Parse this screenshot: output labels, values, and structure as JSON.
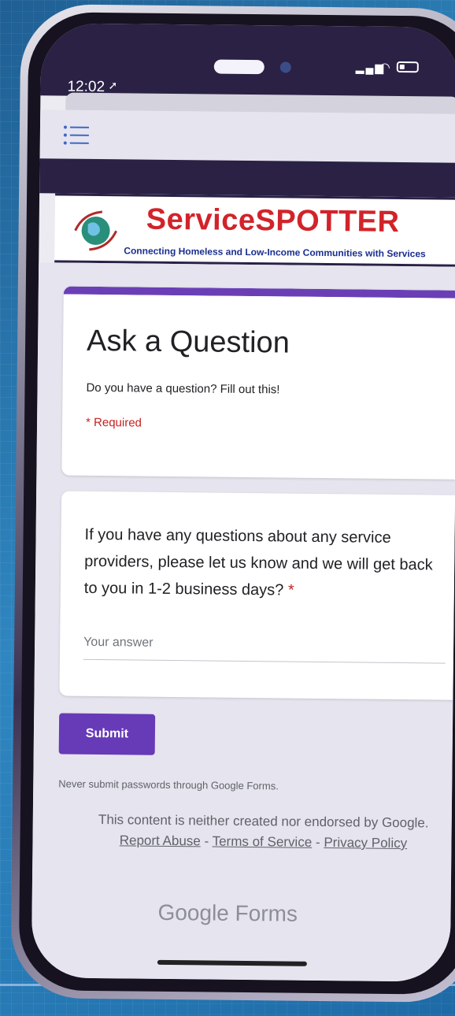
{
  "status_bar": {
    "time": "12:02",
    "location_icon": "location-arrow-icon",
    "signal_icon": "cellular-signal-icon",
    "wifi_icon": "wifi-icon",
    "battery_icon": "battery-icon"
  },
  "browser": {
    "menu_icon": "hamburger-menu-icon"
  },
  "banner": {
    "brand": "ServiceSPOTTER",
    "tagline": "Connecting Homeless and Low-Income Communities with Services",
    "logo_icon": "globe-hands-icon"
  },
  "form": {
    "title": "Ask a Question",
    "description": "Do you have a question? Fill out this!",
    "required_note": "* Required",
    "question": "If you have any questions about any service providers, please let us know and we will get back to you in 1-2 business days?",
    "question_required_mark": "*",
    "answer_placeholder": "Your answer",
    "answer_value": "",
    "submit_label": "Submit"
  },
  "footer": {
    "password_warning": "Never submit passwords through Google Forms.",
    "disclaimer_text": "This content is neither created nor endorsed by Google.",
    "report_abuse": "Report Abuse",
    "separator": "-",
    "terms": "Terms of Service",
    "privacy": "Privacy Policy",
    "brand": "Google Forms"
  },
  "colors": {
    "accent": "#673ab7",
    "brand_red": "#d2232a",
    "brand_blue": "#1a2f8f",
    "required_red": "#c5221f",
    "header_dark": "#2a2145"
  }
}
